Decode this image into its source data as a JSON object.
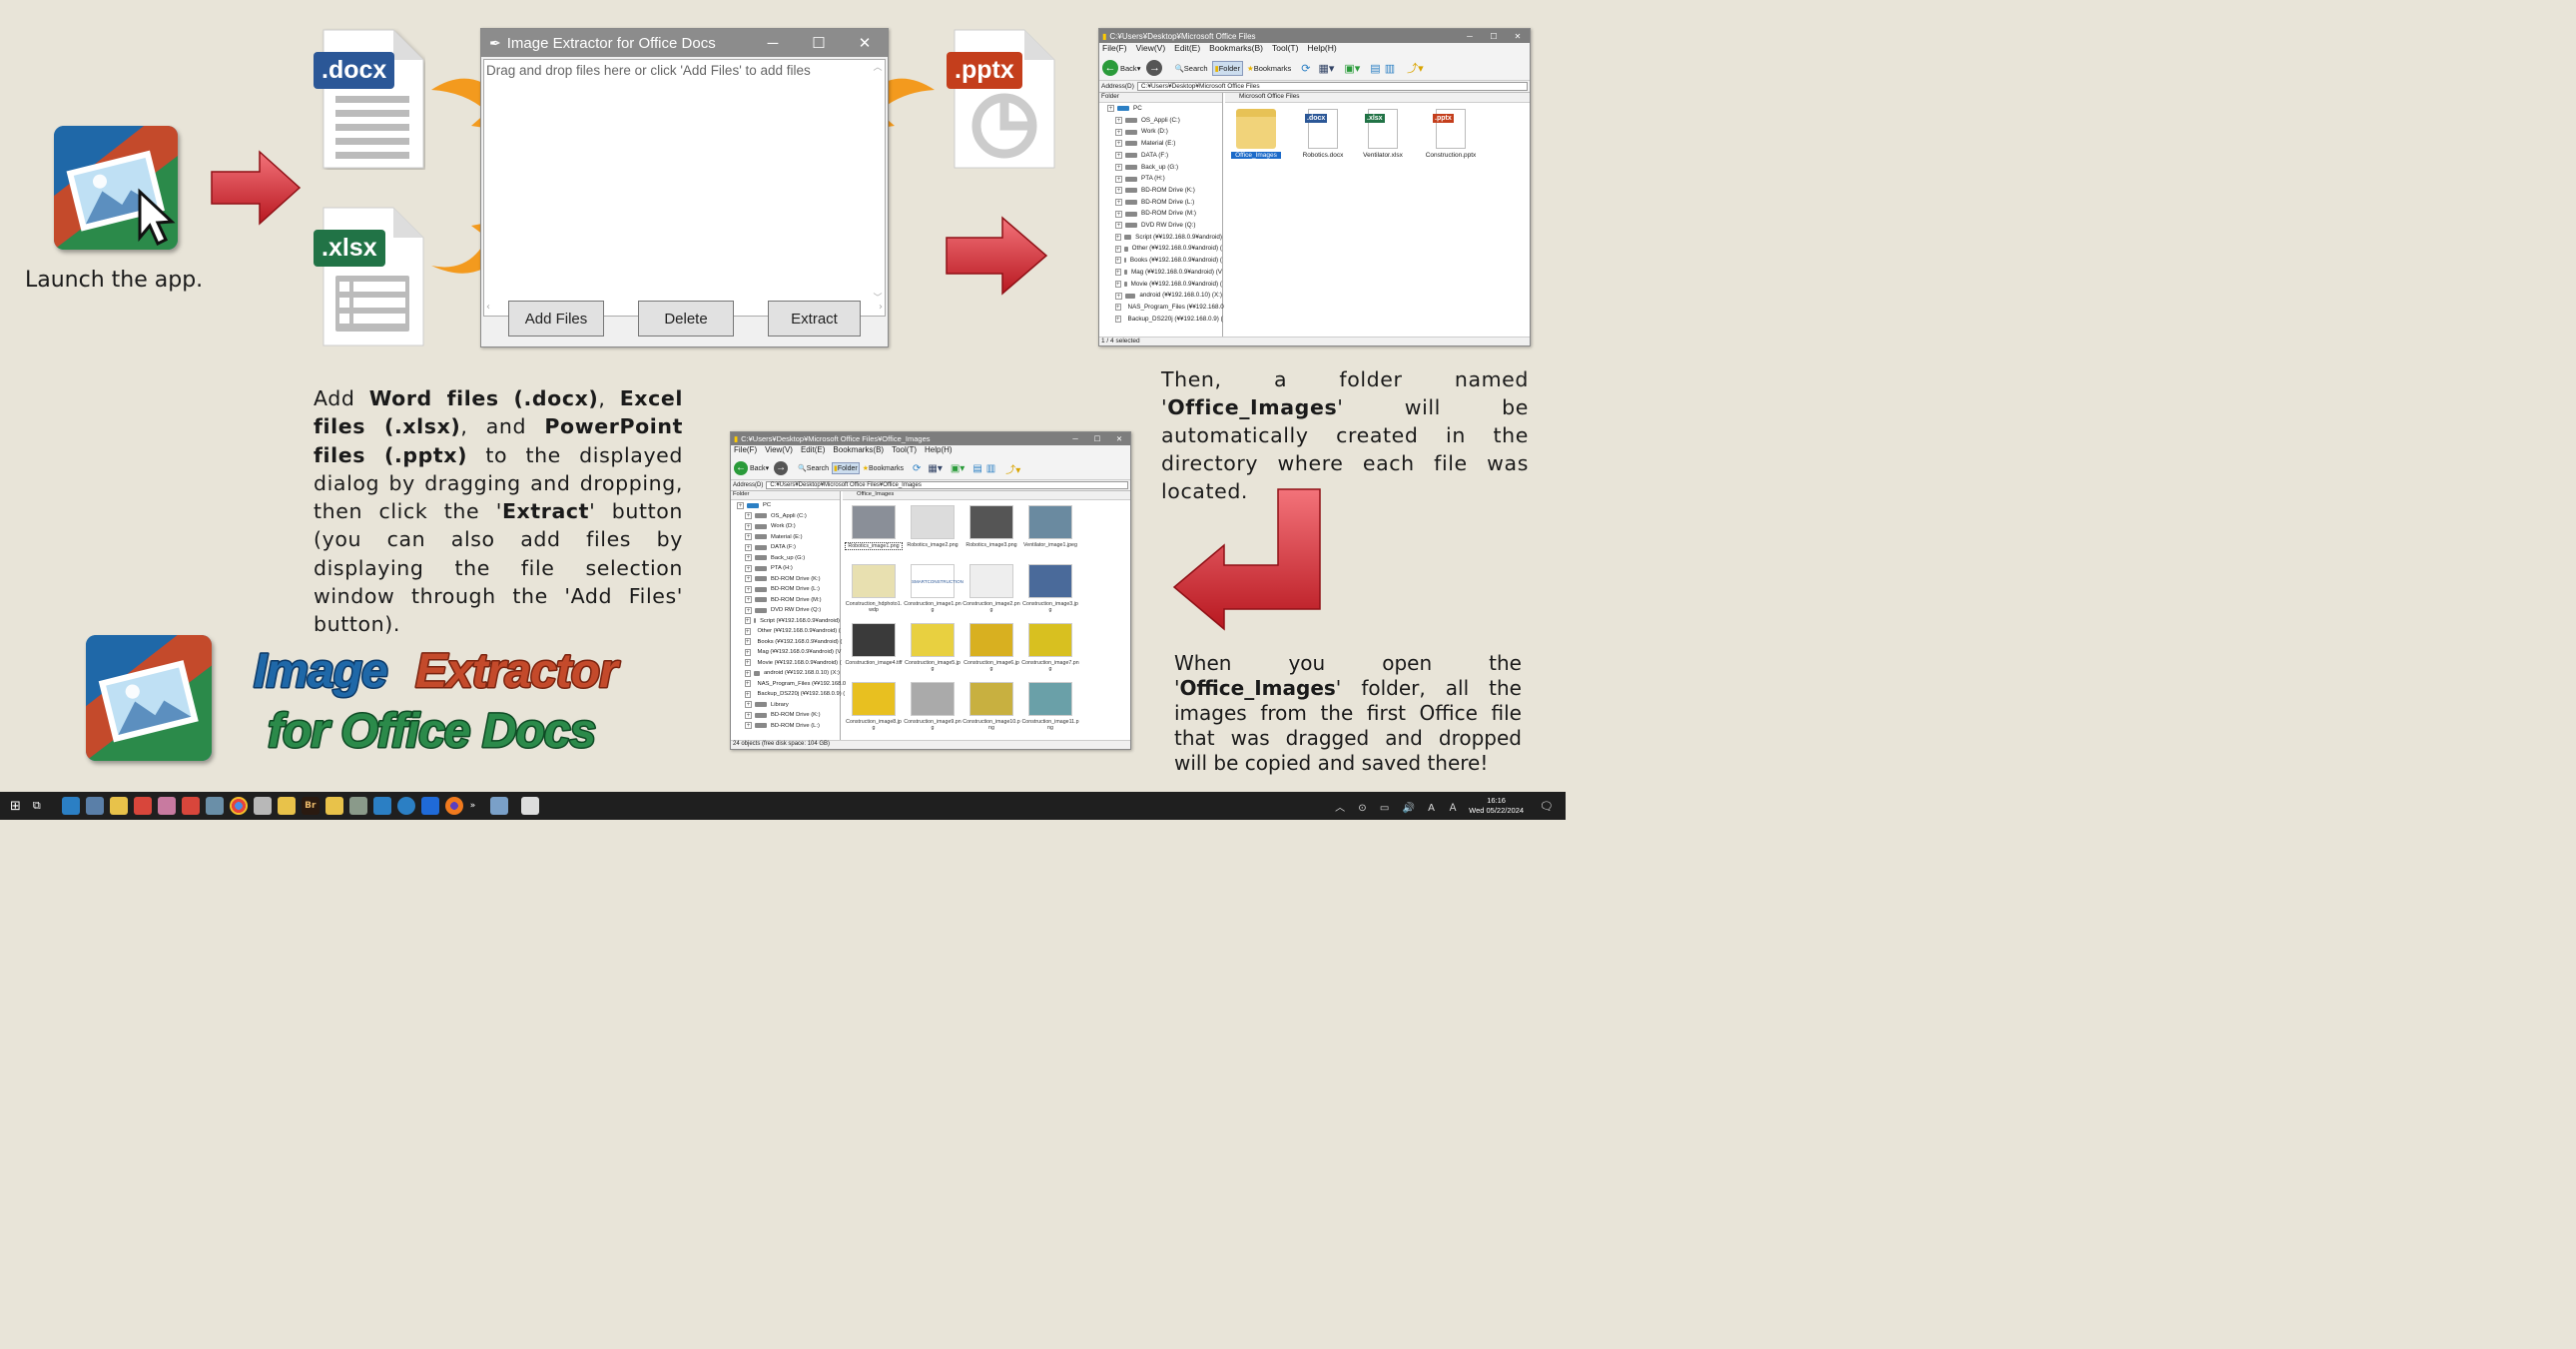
{
  "step1": {
    "caption": "Launch the app."
  },
  "files": {
    "docx": ".docx",
    "xlsx": ".xlsx",
    "pptx": ".pptx"
  },
  "dialog": {
    "title": "Image Extractor for Office Docs",
    "placeholder": "Drag and drop files here or click 'Add Files' to add files",
    "buttons": {
      "add": "Add Files",
      "delete": "Delete",
      "extract": "Extract"
    }
  },
  "instructions": {
    "p1": "Add ",
    "word": "Word files (.docx)",
    "p2": ", ",
    "excel": "Excel files (.xlsx)",
    "p3": ", and ",
    "ppt": "PowerPoint files (.pptx)",
    "p4": " to the displayed dialog by dragging and dropping, then click the '",
    "extract": "Extract",
    "p5": "' button (you can also add files by displaying the file selection window through the 'Add Files' button)."
  },
  "then_text": {
    "p1": "Then, a folder named '",
    "folder": "Office_Images",
    "p2": "' will be automatically created in the directory where each file was located."
  },
  "when_text": {
    "p1": "When you open the '",
    "folder": "Office_Images",
    "p2": "' folder, all the images from the first Office file that was dragged and dropped will be copied and saved there!"
  },
  "logo": {
    "line1a": "Image",
    "line1b": "Extractor",
    "line2": "for Office Docs"
  },
  "explorer1": {
    "title": "C:¥Users¥Desktop¥Microsoft Office Files",
    "menu": [
      "File(F)",
      "View(V)",
      "Edit(E)",
      "Bookmarks(B)",
      "Tool(T)",
      "Help(H)"
    ],
    "back": "Back",
    "search": "Search",
    "folder": "Folder",
    "bookmarks": "Bookmarks",
    "address_label": "Address(D)",
    "address": "C:¥Users¥Desktop¥Microsoft Office Files",
    "folder_header": "Folder",
    "list_header": "Microsoft Office Files",
    "tree": [
      "PC",
      "OS_Appli (C:)",
      "Work (D:)",
      "Material (E:)",
      "DATA (F:)",
      "Back_up (G:)",
      "PTA (H:)",
      "BD-ROM Drive (K:)",
      "BD-ROM Drive (L:)",
      "BD-ROM Drive (M:)",
      "DVD RW Drive (Q:)",
      "Script (¥¥192.168.0.9¥android)",
      "Other (¥¥192.168.0.9¥android) (",
      "Books (¥¥192.168.0.9¥android) (",
      "Mag (¥¥192.168.0.9¥android) (V",
      "Movie (¥¥192.168.0.9¥android) (",
      "android (¥¥192.168.0.10) (X:)",
      "NAS_Program_Files (¥¥192.168.0",
      "Backup_DS220j (¥¥192.168.0.9) ("
    ],
    "items": [
      "Office_Images",
      "Robotics.docx",
      "Ventilator.xlsx",
      "Construction.pptx"
    ],
    "status": "1 / 4 selected"
  },
  "explorer2": {
    "title": "C:¥Users¥Desktop¥Microsoft Office Files¥Office_Images",
    "address": "C:¥Users¥Desktop¥Microsoft Office Files¥Office_Images",
    "list_header": "Office_Images",
    "tree": [
      "PC",
      "OS_Appli (C:)",
      "Work (D:)",
      "Material (E:)",
      "DATA (F:)",
      "Back_up (G:)",
      "PTA (H:)",
      "BD-ROM Drive (K:)",
      "BD-ROM Drive (L:)",
      "BD-ROM Drive (M:)",
      "DVD RW Drive (Q:)",
      "Script (¥¥192.168.0.9¥android)",
      "Other (¥¥192.168.0.9¥android) (",
      "Books (¥¥192.168.0.9¥android) (",
      "Mag (¥¥192.168.0.9¥android) (V",
      "Movie (¥¥192.168.0.9¥android) (",
      "android (¥¥192.168.0.10) (X:)",
      "NAS_Program_Files (¥¥192.168.0",
      "Backup_DS220j (¥¥192.168.0.9) (",
      "Library",
      "BD-ROM Drive (K:)",
      "BD-ROM Drive (L:)"
    ],
    "items": [
      "Robotics_image1.png",
      "Robotics_image2.png",
      "Robotics_image3.png",
      "Ventilator_image1.jpeg",
      "Construction_hdphoto1.wdp",
      "Construction_image1.png",
      "Construction_image2.png",
      "Construction_image3.jpg",
      "Construction_image4.tiff",
      "Construction_image5.jpg",
      "Construction_image6.jpg",
      "Construction_image7.png",
      "Construction_image8.jpg",
      "Construction_image9.png",
      "Construction_image10.png",
      "Construction_image11.png"
    ],
    "status": "24 objects (free disk space: 104 GB)"
  },
  "taskbar": {
    "time": "16:16",
    "date": "Wed 05/22/2024"
  },
  "colors": {
    "bg": "#e8e4d8",
    "docx": "#2b5797",
    "xlsx": "#217346",
    "pptx": "#c43e1c",
    "arrow_red": "#d9262c",
    "arrow_orange": "#f39a1e"
  }
}
